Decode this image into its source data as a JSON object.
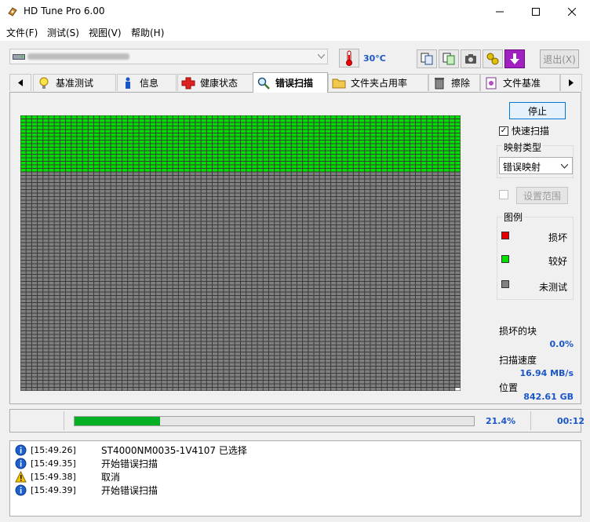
{
  "window": {
    "title": "HD Tune Pro 6.00"
  },
  "menu": [
    "文件(F)",
    "测试(S)",
    "视图(V)",
    "帮助(H)"
  ],
  "toolbar": {
    "temperature": "30°C",
    "exit_label": "退出(X)"
  },
  "tabs": [
    "基准测试",
    "信息",
    "健康状态",
    "错误扫描",
    "文件夹占用率",
    "擦除",
    "文件基准"
  ],
  "active_tab": "错误扫描",
  "controls": {
    "stop_label": "停止",
    "quick_scan_label": "快速扫描",
    "map_type_label": "映射类型",
    "map_type_value": "错误映射",
    "range_label": "设置范围"
  },
  "legend": {
    "title": "图例",
    "items": [
      {
        "label": "损坏",
        "color": "#e40000"
      },
      {
        "label": "较好",
        "color": "#00e000"
      },
      {
        "label": "未测试",
        "color": "#808080"
      }
    ]
  },
  "stats": {
    "damaged_label": "损坏的块",
    "damaged_value": "0.0%",
    "speed_label": "扫描速度",
    "speed_value": "16.94 MB/s",
    "position_label": "位置",
    "position_value": "842.61 GB"
  },
  "scan": {
    "progress_fraction": 0.214,
    "progress_text": "21.4%",
    "elapsed": "00:12",
    "block_grid": {
      "columns": 78,
      "rows": 78,
      "scanned_rows": 16,
      "colors": {
        "good": "#00e000",
        "untested": "#808080",
        "grid": "#3a3a3a"
      }
    }
  },
  "log": [
    {
      "icon": "info",
      "time": "[15:49.26]",
      "message": "ST4000NM0035-1V4107 已选择"
    },
    {
      "icon": "info",
      "time": "[15:49.35]",
      "message": "开始错误扫描"
    },
    {
      "icon": "warning",
      "time": "[15:49.38]",
      "message": "取消"
    },
    {
      "icon": "info",
      "time": "[15:49.39]",
      "message": "开始错误扫描"
    }
  ]
}
